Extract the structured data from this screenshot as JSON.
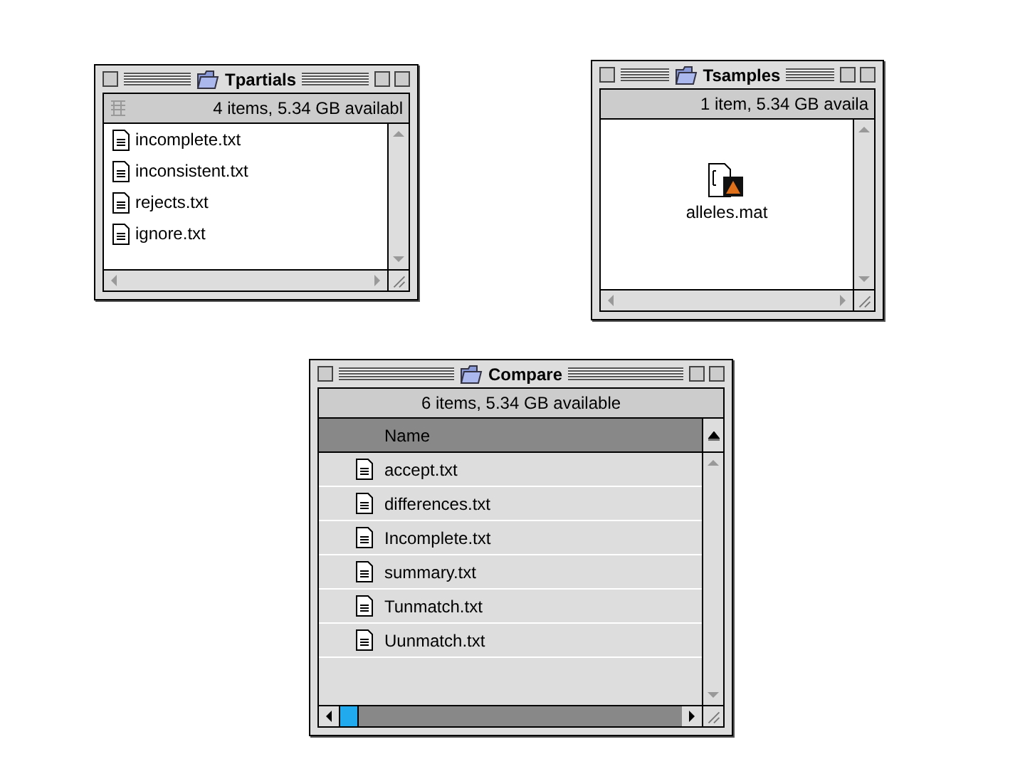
{
  "windows": [
    {
      "title": "Tpartials",
      "kind": "list",
      "info": "4 items, 5.34 GB availabl",
      "items": [
        "incomplete.txt",
        "inconsistent.txt",
        "rejects.txt",
        "ignore.txt"
      ]
    },
    {
      "title": "Tsamples",
      "kind": "icons",
      "info": "1 item, 5.34 GB availa",
      "items": [
        "alleles.mat"
      ]
    },
    {
      "title": "Compare",
      "kind": "table",
      "info": "6 items, 5.34 GB available",
      "header": "Name",
      "items": [
        "accept.txt",
        "differences.txt",
        "Incomplete.txt",
        "summary.txt",
        "Tunmatch.txt",
        "Uunmatch.txt"
      ]
    }
  ]
}
